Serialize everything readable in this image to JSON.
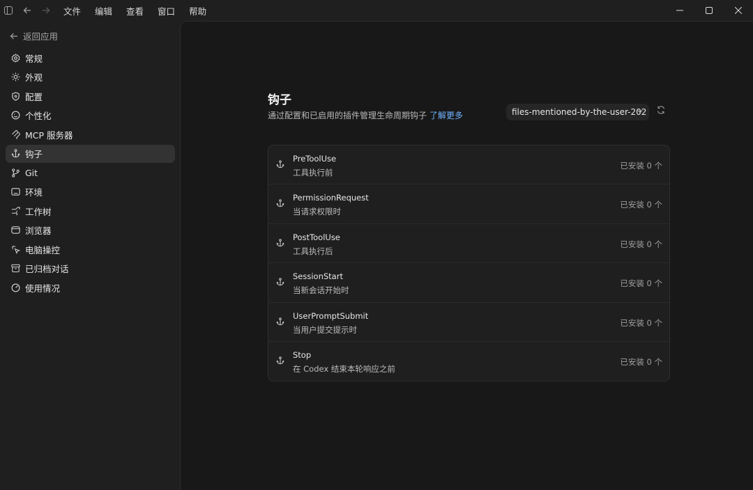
{
  "menu": [
    "文件",
    "编辑",
    "查看",
    "窗口",
    "帮助"
  ],
  "sidebar": {
    "back_label": "返回应用",
    "items": [
      {
        "label": "常规",
        "icon": "gear-icon"
      },
      {
        "label": "外观",
        "icon": "sun-icon"
      },
      {
        "label": "配置",
        "icon": "shield-icon"
      },
      {
        "label": "个性化",
        "icon": "smile-icon"
      },
      {
        "label": "MCP 服务器",
        "icon": "mcp-icon"
      },
      {
        "label": "钩子",
        "icon": "anchor-icon",
        "active": true
      },
      {
        "label": "Git",
        "icon": "git-branch-icon"
      },
      {
        "label": "环境",
        "icon": "terminal-icon"
      },
      {
        "label": "工作树",
        "icon": "worktree-icon"
      },
      {
        "label": "浏览器",
        "icon": "browser-icon"
      },
      {
        "label": "电脑操控",
        "icon": "cursor-click-icon"
      },
      {
        "label": "已归档对话",
        "icon": "archive-icon"
      },
      {
        "label": "使用情况",
        "icon": "gauge-icon"
      }
    ]
  },
  "main": {
    "title": "钩子",
    "subtitle": "通过配置和已启用的插件管理生命周期钩子",
    "learn_more": "了解更多",
    "selected_project": "files-mentioned-by-the-user-202",
    "hooks": [
      {
        "name": "PreToolUse",
        "desc": "工具执行前",
        "count": "已安装 0 个"
      },
      {
        "name": "PermissionRequest",
        "desc": "当请求权限时",
        "count": "已安装 0 个"
      },
      {
        "name": "PostToolUse",
        "desc": "工具执行后",
        "count": "已安装 0 个"
      },
      {
        "name": "SessionStart",
        "desc": "当新会话开始时",
        "count": "已安装 0 个"
      },
      {
        "name": "UserPromptSubmit",
        "desc": "当用户提交提示时",
        "count": "已安装 0 个"
      },
      {
        "name": "Stop",
        "desc": "在 Codex 结束本轮响应之前",
        "count": "已安装 0 个"
      }
    ]
  },
  "colors": {
    "background": "#1f1f1f",
    "panel": "#181818",
    "active_nav": "#333333",
    "link": "#6fb3ff"
  }
}
